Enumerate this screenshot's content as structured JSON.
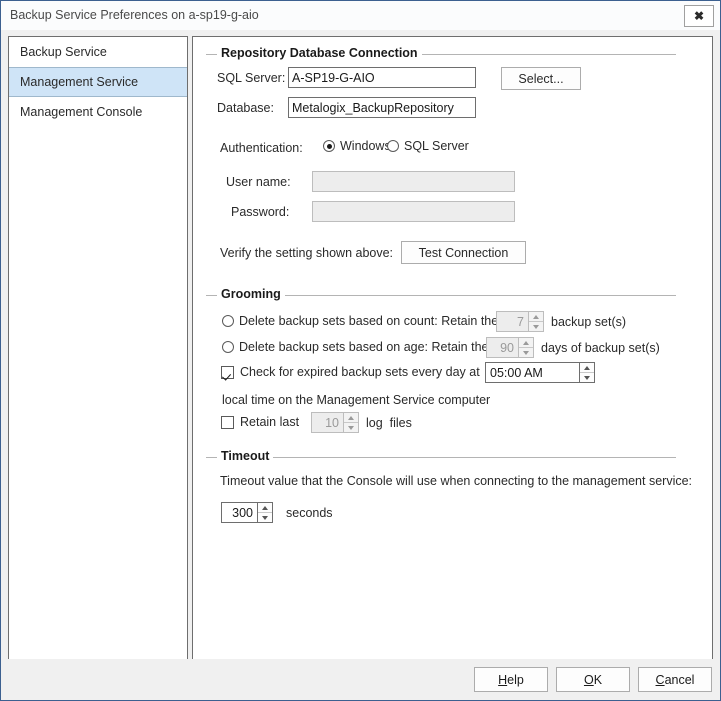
{
  "window": {
    "title": "Backup Service Preferences on a-sp19-g-aio",
    "close_icon": "close-icon",
    "close_glyph": "✖",
    "border_color": "#3c6090",
    "accent_selected": "#cfe4f7"
  },
  "sidebar": {
    "items": [
      {
        "label": "Backup Service",
        "selected": false
      },
      {
        "label": "Management Service",
        "selected": true
      },
      {
        "label": "Management Console",
        "selected": false
      }
    ]
  },
  "repository": {
    "legend": "Repository Database Connection",
    "sql_server_label": "SQL Server:",
    "sql_server_value": "A-SP19-G-AIO",
    "select_button": "Select...",
    "database_label": "Database:",
    "database_value": "Metalogix_BackupRepository",
    "authentication_label": "Authentication:",
    "auth_windows": "Windows",
    "auth_sql_server": "SQL Server",
    "auth_selected": "Windows",
    "user_name_label": "User name:",
    "user_name_value": "",
    "password_label": "Password:",
    "password_value": "",
    "verify_label": "Verify the setting shown above:",
    "test_button": "Test Connection"
  },
  "grooming": {
    "legend": "Grooming",
    "count_radio_label": "Delete backup sets based on count: Retain the last",
    "count_radio_checked": false,
    "count_value": "7",
    "count_suffix": "backup set(s)",
    "age_radio_label": "Delete backup sets based on age: Retain the last",
    "age_radio_checked": false,
    "age_value": "90",
    "age_suffix": "days of backup set(s)",
    "expired_checkbox_label": "Check for expired backup sets every day at",
    "expired_checkbox_checked": true,
    "expired_time_value": "05:00 AM",
    "local_time_note": "local time on the Management Service computer",
    "retain_logs_label": "Retain last",
    "retain_logs_checked": false,
    "retain_logs_value": "10",
    "retain_logs_suffix": "log  files"
  },
  "timeout": {
    "legend": "Timeout",
    "description": "Timeout value that the Console will use when connecting to the management service:",
    "value": "300",
    "unit": "seconds"
  },
  "footer": {
    "help_accel": "H",
    "help_rest": "elp",
    "ok_accel": "O",
    "ok_rest": "K",
    "cancel_accel": "C",
    "cancel_rest": "ancel"
  }
}
